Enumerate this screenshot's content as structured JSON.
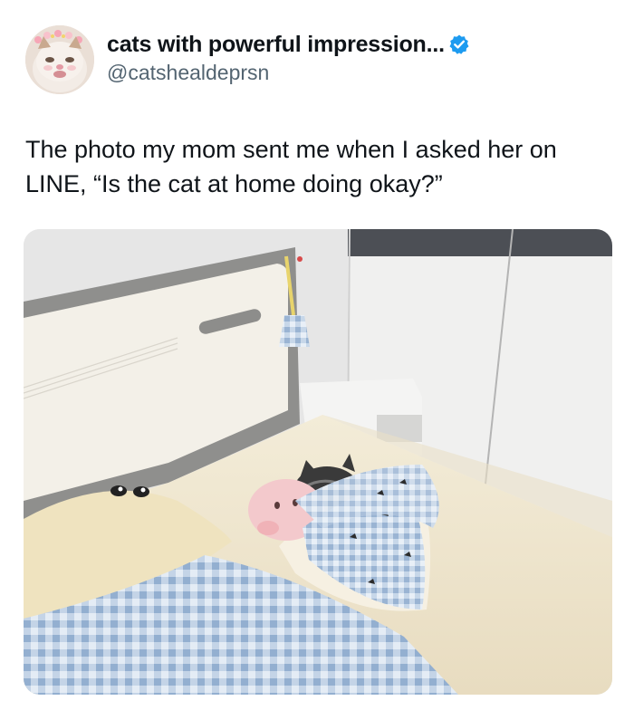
{
  "author": {
    "display_name": "cats with powerful impression...",
    "handle": "@catshealdeprsn",
    "verified": true,
    "avatar_icon": "cat-avatar-icon",
    "verified_icon": "verified-badge-icon",
    "verified_color": "#1d9bf0"
  },
  "tweet": {
    "text": "The photo my mom sent me when I asked her on LINE, “Is the cat at home doing okay?”"
  },
  "media": {
    "description_icon": "cat-in-bed-photo",
    "colors": {
      "wall": "#ececec",
      "headboard": "#f2efe7",
      "headboard_trim": "#8e8e8c",
      "bedsheet": "#efe6cf",
      "gingham": "#a9c1dc"
    }
  }
}
